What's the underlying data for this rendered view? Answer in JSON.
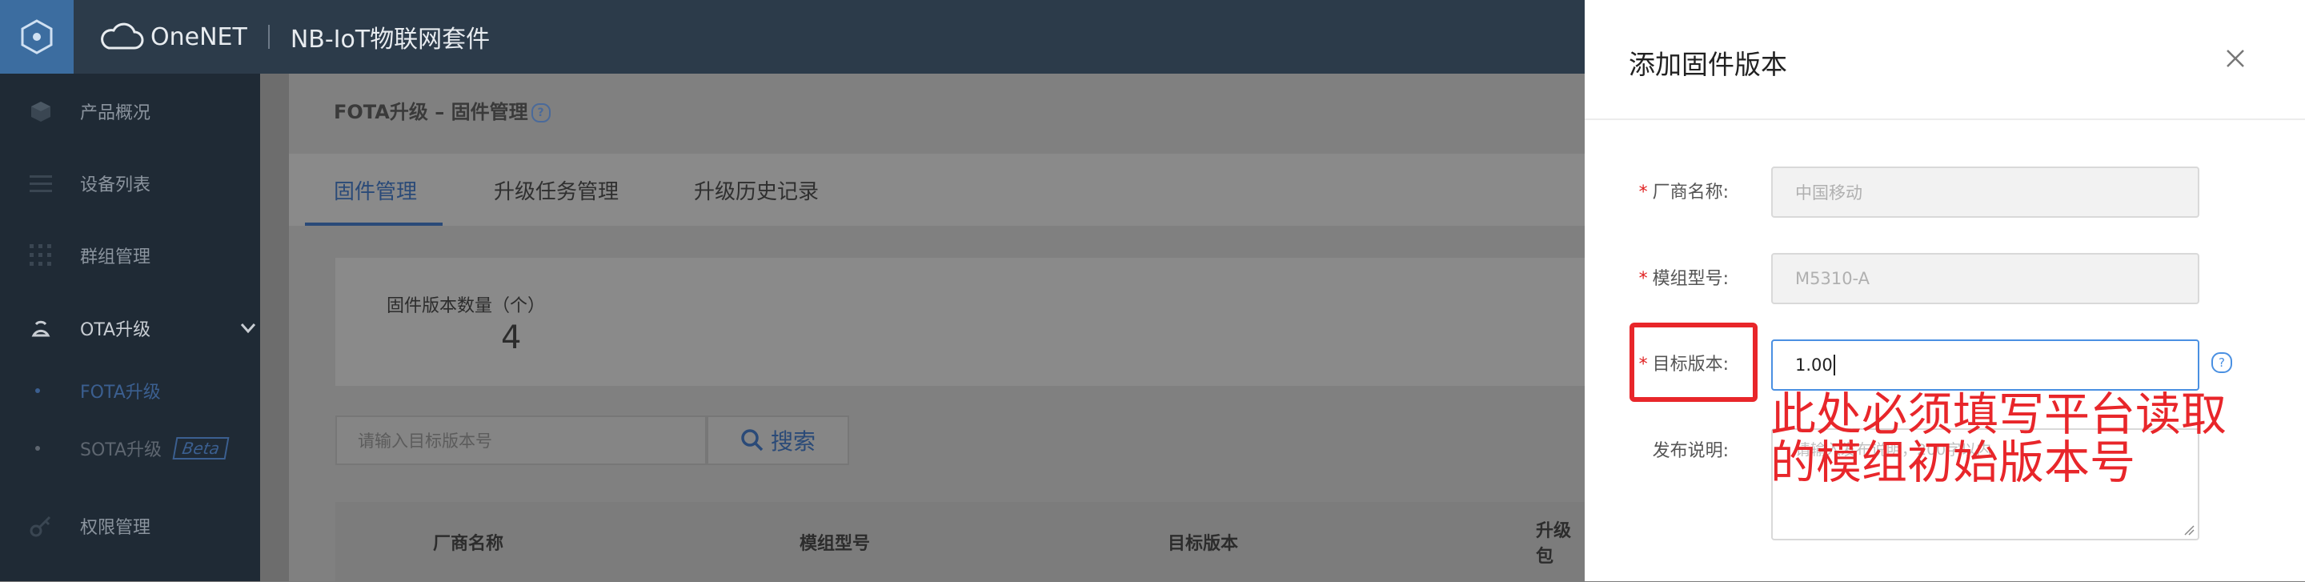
{
  "topbar": {
    "brand": "OneNET",
    "suite": "NB-IoT物联网套件"
  },
  "sidebar": {
    "items": [
      {
        "label": "产品概况",
        "icon": "cube-icon"
      },
      {
        "label": "设备列表",
        "icon": "list-icon"
      },
      {
        "label": "群组管理",
        "icon": "grid-icon"
      },
      {
        "label": "OTA升级",
        "icon": "ota-icon"
      },
      {
        "label": "权限管理",
        "icon": "key-icon"
      }
    ],
    "subitems": [
      {
        "label": "FOTA升级",
        "active": true
      },
      {
        "label": "SOTA升级",
        "badge": "Beta"
      }
    ]
  },
  "main": {
    "breadcrumb": "FOTA升级 – 固件管理",
    "tabs": [
      {
        "label": "固件管理",
        "active": true
      },
      {
        "label": "升级任务管理"
      },
      {
        "label": "升级历史记录"
      }
    ],
    "stat": {
      "label": "固件版本数量（个）",
      "value": "4"
    },
    "search": {
      "placeholder": "请输入目标版本号",
      "button_label": "搜索"
    },
    "table_headers": [
      "厂商名称",
      "模组型号",
      "目标版本",
      "升级包"
    ]
  },
  "drawer": {
    "title": "添加固件版本",
    "fields": [
      {
        "label": "厂商名称:",
        "value": "中国移动",
        "required": true
      },
      {
        "label": "模组型号:",
        "value": "M5310-A",
        "required": true
      },
      {
        "label": "目标版本:",
        "value": "1.00",
        "required": true
      },
      {
        "label": "发布说明:",
        "placeholder": "请输入发布说明，200字以内",
        "required": false
      }
    ],
    "annotation_line1": "此处必须填写平台读取",
    "annotation_line2": "的模组初始版本号"
  },
  "colors": {
    "accent": "#2a4a78",
    "annotation": "#e8262a",
    "input_focus": "#4a90e2"
  }
}
